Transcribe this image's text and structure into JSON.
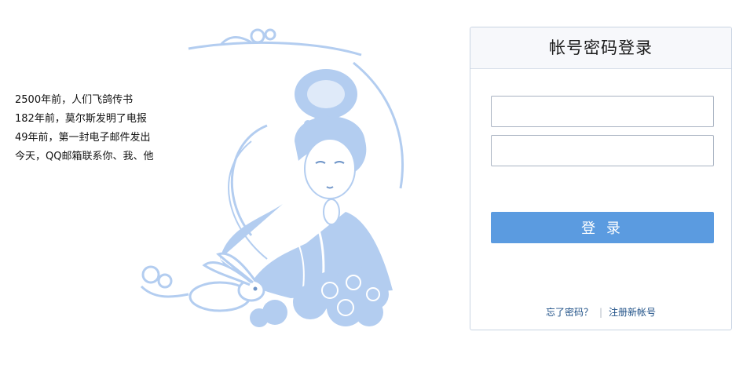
{
  "intro": {
    "lines": [
      "2500年前，人们飞鸽传书",
      "182年前，莫尔斯发明了电报",
      "49年前，第一封电子邮件发出",
      "今天，QQ邮箱联系你、我、他"
    ]
  },
  "illustration": {
    "icon": "moon-goddess-with-rabbit-illustration",
    "color": "#b3cdf0"
  },
  "login": {
    "title": "帐号密码登录",
    "account_value": "",
    "password_value": "",
    "login_label": "登 录",
    "forgot_label": "忘了密码？",
    "separator": "|",
    "register_label": "注册新帐号",
    "accent_color": "#5b9be0"
  }
}
